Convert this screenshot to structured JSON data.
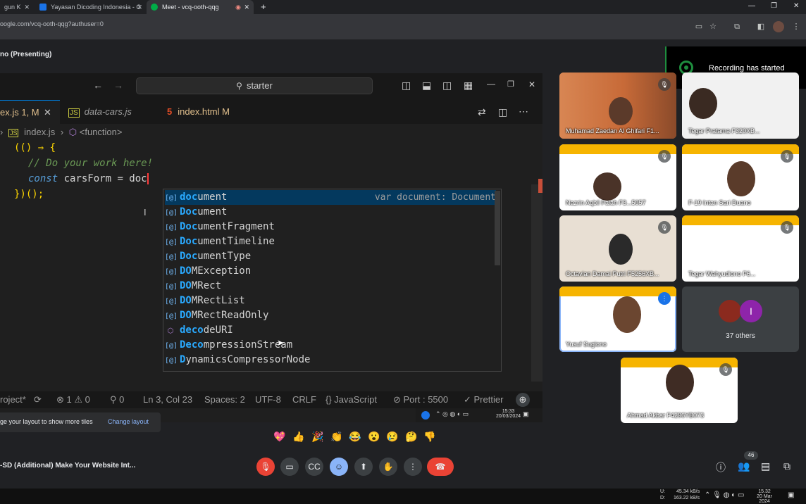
{
  "browser": {
    "tabs": [
      {
        "title": "gun K",
        "icon": "page-icon"
      },
      {
        "title": "Yayasan Dicoding Indonesia - C",
        "icon": "dicoding-icon"
      },
      {
        "title": "Meet - vcq-ooth-qqg",
        "icon": "meet-icon"
      }
    ],
    "url": "oogle.com/vcq-ooth-qqg?authuser=0",
    "new_tab": "+"
  },
  "meet": {
    "presenting_label": "no (Presenting)",
    "recording_notice": "Recording has started",
    "layout_hint": "ge your layout to show more tiles",
    "change_layout": "Change layout",
    "meeting_title": "-SD (Additional) Make Your Website Int...",
    "participants_count": "46",
    "others_label": "37 others",
    "others_initial": "I",
    "reactions": [
      "💖",
      "👍",
      "🎉",
      "👏",
      "😂",
      "😮",
      "😢",
      "🤔",
      "👎"
    ]
  },
  "participants": [
    {
      "name": "Muhamad Zaedan Al Ghifari F1..."
    },
    {
      "name": "Tegar Pratama F320XB..."
    },
    {
      "name": "Nazrin Aqbil Falah F3...5057"
    },
    {
      "name": "F-19 Intan Sari Duano"
    },
    {
      "name": "Octavian Damai Putri F5256XB..."
    },
    {
      "name": "Tegar Wahyudiono F6..."
    },
    {
      "name": "Yusuf Sugiono"
    },
    {
      "name": "Ahmad Akbar F4296YB073"
    }
  ],
  "vscode": {
    "command_center": "starter",
    "tabs": [
      {
        "label": "ex.js 1, M",
        "type": "js"
      },
      {
        "label": "data-cars.js",
        "type": "js"
      },
      {
        "label": "index.html M",
        "type": "html"
      }
    ],
    "breadcrumb": {
      "file": "index.js",
      "symbol": "<function>"
    },
    "code": {
      "line1": "(() ⇒ {",
      "line2": "// Do your work here!",
      "line3_kw": "const",
      "line3_rest": " carsForm = doc",
      "line4": "})();"
    },
    "suggestion_detail": "var document: Document",
    "suggestions": [
      {
        "pre": "",
        "hl": "doc",
        "post": "ument",
        "kind": "var"
      },
      {
        "pre": "",
        "hl": "Doc",
        "post": "ument",
        "kind": "var"
      },
      {
        "pre": "",
        "hl": "Doc",
        "post": "umentFragment",
        "kind": "var"
      },
      {
        "pre": "",
        "hl": "Doc",
        "post": "umentTimeline",
        "kind": "var"
      },
      {
        "pre": "",
        "hl": "Doc",
        "post": "umentType",
        "kind": "var"
      },
      {
        "pre": "",
        "hl": "DO",
        "post": "MException",
        "kind": "var"
      },
      {
        "pre": "",
        "hl": "DO",
        "post": "MRect",
        "kind": "var"
      },
      {
        "pre": "",
        "hl": "DO",
        "post": "MRectList",
        "kind": "var"
      },
      {
        "pre": "",
        "hl": "DO",
        "post": "MRectReadOnly",
        "kind": "var"
      },
      {
        "pre": "",
        "hl": "deco",
        "post": "deURI",
        "kind": "function"
      },
      {
        "pre": "",
        "hl": "Deco",
        "post": "mpressionStream",
        "kind": "var"
      },
      {
        "pre": "",
        "hl": "D",
        "post": "ynamicsCompressorNode",
        "kind": "var"
      }
    ],
    "status": {
      "project": "roject*",
      "errors": "1",
      "warnings": "0",
      "ports_count": "0",
      "position": "Ln 3, Col 23",
      "spaces": "Spaces: 2",
      "encoding": "UTF-8",
      "eol": "CRLF",
      "language": "JavaScript",
      "port": "Port : 5500",
      "prettier": "Prettier"
    },
    "inner_clock": {
      "time": "15:33",
      "date": "20/03/2024"
    }
  },
  "taskbar": {
    "up": "U:",
    "down": "D:",
    "up_rate": "45.34 kB/s",
    "down_rate": "163.22 kB/s",
    "time": "15.32",
    "date": "20 Mar 2024"
  },
  "colors": {
    "meet_bg": "#202124",
    "recording_green": "#1e8e3e",
    "end_call": "#ea4335",
    "mic_off": "#ea4335",
    "vscode_bg": "#1f1f1f",
    "suggest_highlight": "#2aaaff"
  }
}
